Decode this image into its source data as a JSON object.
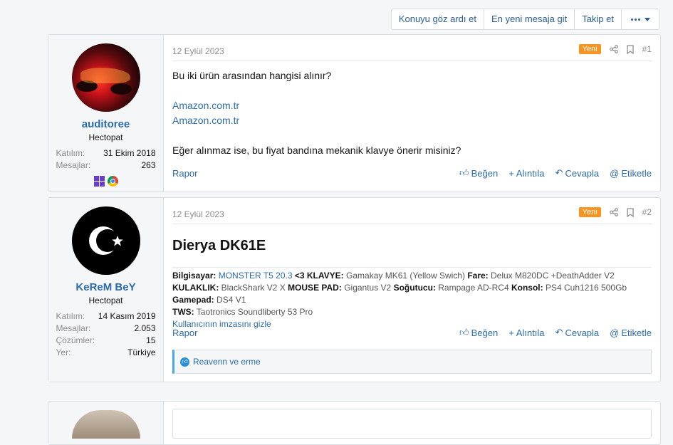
{
  "topbar": {
    "ignore": "Konuyu göz ardı et",
    "latest": "En yeni mesaja git",
    "follow": "Takip et",
    "more_icon": "ellipsis-dropdown-icon"
  },
  "labels": {
    "report": "Rapor",
    "like": "Beğen",
    "quote": "Alıntıla",
    "reply": "Cevapla",
    "tag": "Etiketle",
    "new_badge": "Yeni"
  },
  "posts": [
    {
      "date": "12 Eylül 2023",
      "number": "#1",
      "user": {
        "name": "auditoree",
        "role": "Hectopat",
        "stats": [
          {
            "k": "Katılım:",
            "v": "31 Ekim 2018"
          },
          {
            "k": "Mesajlar:",
            "v": "263"
          }
        ]
      },
      "content": {
        "line1": "Bu iki ürün arasından hangisi alınır?",
        "link1": "Amazon.com.tr",
        "link2": "Amazon.com.tr",
        "line2": "Eğer alınmaz ise, bu fiyat bandına mekanik klavye önerir misiniz?"
      }
    },
    {
      "date": "12 Eylül 2023",
      "number": "#2",
      "user": {
        "name": "KeReM BeY",
        "role": "Hectopat",
        "stats": [
          {
            "k": "Katılım:",
            "v": "14 Kasım 2019"
          },
          {
            "k": "Mesajlar:",
            "v": "2.053"
          },
          {
            "k": "Çözümler:",
            "v": "15"
          },
          {
            "k": "Yer:",
            "v": "Türkiye"
          }
        ]
      },
      "title": "Dierya DK61E",
      "signature": {
        "l_pc": "Bilgisayar:",
        "v_pc": "MONSTER T5 20.3",
        "heart": "<3",
        "l_kb": "KLAVYE:",
        "v_kb": "Gamakay MK61 (Yellow Swich)",
        "l_fare": "Fare:",
        "v_fare": "Delux M820DC +DeathAdder V2",
        "l_kulak": "KULAKLIK:",
        "v_kulak": "BlackShark V2 X",
        "l_pad": "MOUSE PAD:",
        "v_pad": "Gigantus V2",
        "l_cool": "Soğutucu:",
        "v_cool": "Rampage AD-RC4",
        "l_kon": "Konsol:",
        "v_kon": "PS4 Cuh1216 500Gb",
        "l_gp": "Gamepad:",
        "v_gp": "DS4 V1",
        "l_tws": "TWS:",
        "v_tws": "Taotronics Soundliberty 53 Pro",
        "hide": "Kullanıcının imzasını gizle"
      },
      "reactions": "Reavenn ve erme"
    }
  ]
}
